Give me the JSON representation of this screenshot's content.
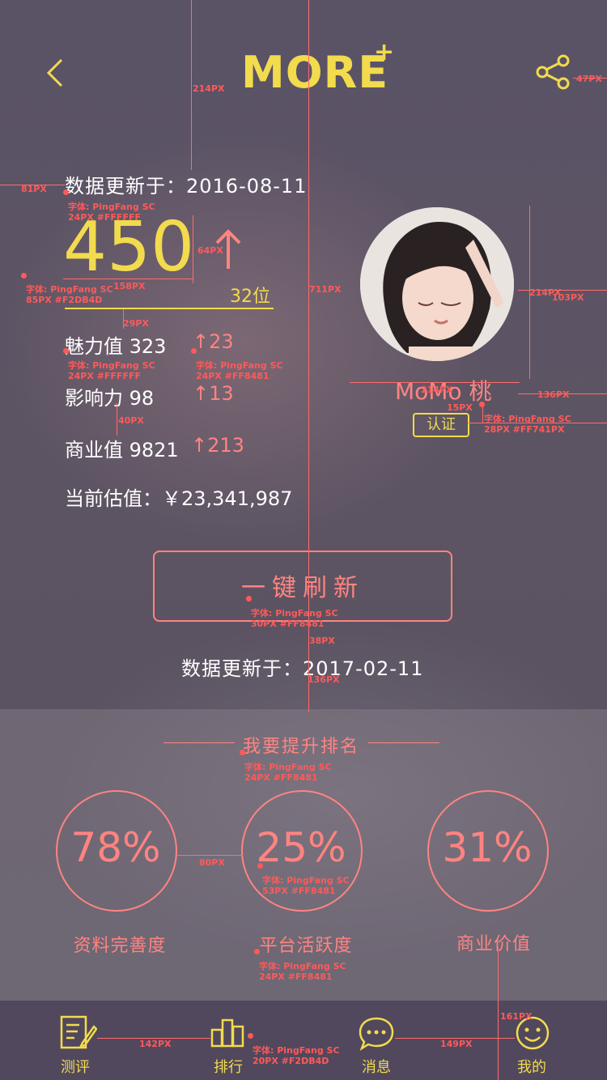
{
  "header": {
    "logo": "MORE",
    "logo_plus": "+"
  },
  "stats": {
    "update_line": "数据更新于：2016-08-11",
    "score": "450",
    "rank": "32位",
    "rows": [
      {
        "label": "魅力值 323",
        "delta": "↑23"
      },
      {
        "label": "影响力 98",
        "delta": "↑13"
      },
      {
        "label": "商业值 9821",
        "delta": "↑213"
      }
    ],
    "valuation": "当前估值：￥23,341,987"
  },
  "profile": {
    "name": "MoMo 桃",
    "badge": "认证"
  },
  "refresh": {
    "label": "一键刷新",
    "update_line": "数据更新于：2017-02-11"
  },
  "ranking": {
    "title": "我要提升排名",
    "metrics": [
      {
        "percent": "78%",
        "label": "资料完善度"
      },
      {
        "percent": "25%",
        "label": "平台活跃度"
      },
      {
        "percent": "31%",
        "label": "商业价值"
      }
    ]
  },
  "tabs": [
    {
      "label": "测评",
      "icon": "review-icon"
    },
    {
      "label": "排行",
      "icon": "ranking-icon"
    },
    {
      "label": "消息",
      "icon": "message-icon"
    },
    {
      "label": "我的",
      "icon": "profile-icon"
    }
  ],
  "annotations": {
    "a1": "214PX",
    "a2": "47PX",
    "a3": "81PX",
    "f_update": "字体: PingFang SC",
    "f_update2": "24PX #FFFFFF",
    "a4": "64PX",
    "f_score": "字体: PingFang SC",
    "f_score2": "85PX #F2DB4D",
    "a5": "158PX",
    "a6": "711PX",
    "a7": "214PX",
    "a8": "103PX",
    "a9": "29PX",
    "f_stat": "字体: PingFang SC",
    "f_stat2": "24PX #FFFFFF",
    "f_delta": "字体: PingFang SC",
    "f_delta2": "24PX #FF8481",
    "a10": "214PX",
    "a11": "136PX",
    "a12": "15PX",
    "f_name": "字体: PingFang SC",
    "f_name2": "28PX #FF741PX",
    "a13": "40PX",
    "f_btn": "字体: PingFang SC",
    "f_btn2": "30PX #FF8481",
    "a14": "38PX",
    "a15": "136PX",
    "f_rank": "字体: PingFang SC",
    "f_rank2": "24PX #FF8481",
    "a16": "80PX",
    "f_pct": "字体: PingFang SC",
    "f_pct2": "53PX #FF8481",
    "f_cap": "字体: PingFang SC",
    "f_cap2": "24PX #FF8481",
    "a17": "161PX",
    "a18": "142PX",
    "a19": "149PX",
    "f_tab": "字体: PingFang SC",
    "f_tab2": "20PX #F2DB4D"
  },
  "colors": {
    "yellow": "#F2DB4D",
    "pink": "#FF8481",
    "white": "#FFFFFF"
  }
}
